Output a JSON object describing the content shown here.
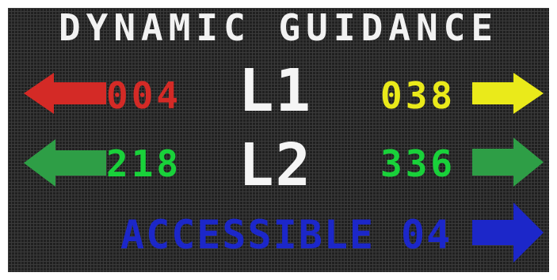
{
  "sign": {
    "title": "DYNAMIC GUIDANCE",
    "rows": [
      {
        "level": "L1",
        "left": {
          "count": "004",
          "direction": "left",
          "color": "#d42a26",
          "icon": "left-arrow-icon"
        },
        "right": {
          "count": "038",
          "direction": "right",
          "color": "#eaea1a",
          "icon": "right-arrow-icon"
        }
      },
      {
        "level": "L2",
        "left": {
          "count": "218",
          "direction": "left",
          "color": "#2e9e46",
          "icon": "left-arrow-icon"
        },
        "right": {
          "count": "336",
          "direction": "right",
          "color": "#2e9e46",
          "icon": "right-arrow-icon"
        }
      }
    ],
    "accessible": {
      "label": "ACCESSIBLE",
      "count": "04",
      "direction": "right",
      "color": "#1c27c9",
      "icon": "right-arrow-icon"
    },
    "colors": {
      "panel_background": "#202020",
      "grid_dots": "#3a3a3a",
      "text_white": "#f5f5f5",
      "count_l1_left": "#d42a26",
      "count_l1_right": "#eaea1a",
      "count_l2": "#19d13a",
      "accessible_text": "#1c27c9"
    }
  }
}
